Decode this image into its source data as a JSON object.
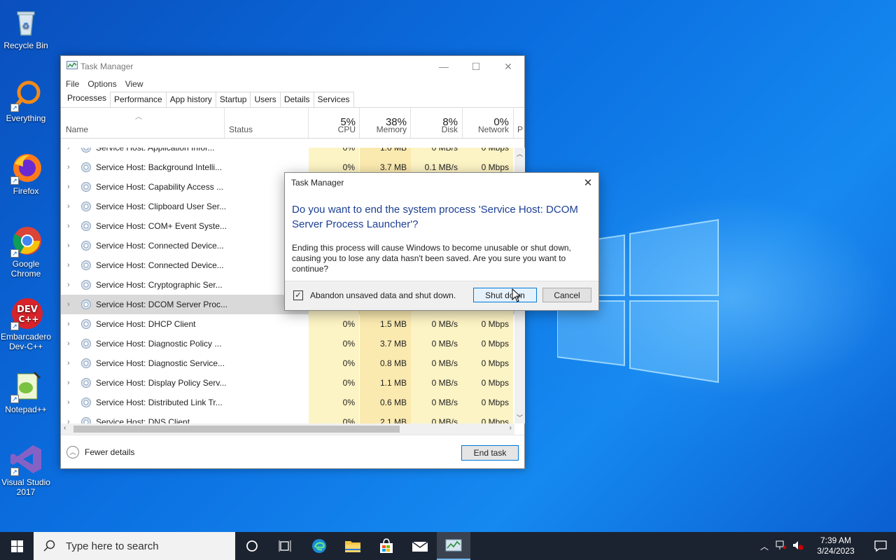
{
  "desktop": {
    "icons": [
      {
        "label": "Recycle Bin"
      },
      {
        "label": "Everything"
      },
      {
        "label": "Firefox"
      },
      {
        "label": "Google Chrome"
      },
      {
        "label": "Embarcadero Dev-C++"
      },
      {
        "label": "Notepad++"
      },
      {
        "label": "Visual Studio 2017"
      }
    ]
  },
  "task_manager": {
    "title": "Task Manager",
    "menu": [
      "File",
      "Options",
      "View"
    ],
    "tabs": [
      "Processes",
      "Performance",
      "App history",
      "Startup",
      "Users",
      "Details",
      "Services"
    ],
    "active_tab": "Processes",
    "columns": {
      "name": "Name",
      "status": "Status",
      "cpu": {
        "pct": "5%",
        "label": "CPU"
      },
      "memory": {
        "pct": "38%",
        "label": "Memory"
      },
      "disk": {
        "pct": "8%",
        "label": "Disk"
      },
      "network": {
        "pct": "0%",
        "label": "Network"
      },
      "power": "P"
    },
    "rows": [
      {
        "name": "Service Host: Application Infor...",
        "cpu": "0%",
        "mem": "1.0 MB",
        "disk": "0 MB/s",
        "net": "0 Mbps"
      },
      {
        "name": "Service Host: Background Intelli...",
        "cpu": "0%",
        "mem": "3.7 MB",
        "disk": "0.1 MB/s",
        "net": "0 Mbps"
      },
      {
        "name": "Service Host: Capability Access ...",
        "cpu": "",
        "mem": "",
        "disk": "",
        "net": ""
      },
      {
        "name": "Service Host: Clipboard User Ser...",
        "cpu": "",
        "mem": "",
        "disk": "",
        "net": ""
      },
      {
        "name": "Service Host: COM+ Event Syste...",
        "cpu": "",
        "mem": "",
        "disk": "",
        "net": ""
      },
      {
        "name": "Service Host: Connected Device...",
        "cpu": "",
        "mem": "",
        "disk": "",
        "net": ""
      },
      {
        "name": "Service Host: Connected Device...",
        "cpu": "",
        "mem": "",
        "disk": "",
        "net": ""
      },
      {
        "name": "Service Host: Cryptographic Ser...",
        "cpu": "",
        "mem": "",
        "disk": "",
        "net": ""
      },
      {
        "name": "Service Host: DCOM Server Proc...",
        "cpu": "",
        "mem": "",
        "disk": "",
        "net": "",
        "selected": true
      },
      {
        "name": "Service Host: DHCP Client",
        "cpu": "0%",
        "mem": "1.5 MB",
        "disk": "0 MB/s",
        "net": "0 Mbps"
      },
      {
        "name": "Service Host: Diagnostic Policy ...",
        "cpu": "0%",
        "mem": "3.7 MB",
        "disk": "0 MB/s",
        "net": "0 Mbps"
      },
      {
        "name": "Service Host: Diagnostic Service...",
        "cpu": "0%",
        "mem": "0.8 MB",
        "disk": "0 MB/s",
        "net": "0 Mbps"
      },
      {
        "name": "Service Host: Display Policy Serv...",
        "cpu": "0%",
        "mem": "1.1 MB",
        "disk": "0 MB/s",
        "net": "0 Mbps"
      },
      {
        "name": "Service Host: Distributed Link Tr...",
        "cpu": "0%",
        "mem": "0.6 MB",
        "disk": "0 MB/s",
        "net": "0 Mbps"
      },
      {
        "name": "Service Host: DNS Client",
        "cpu": "0%",
        "mem": "2.1 MB",
        "disk": "0 MB/s",
        "net": "0 Mbps"
      }
    ],
    "fewer_details": "Fewer details",
    "end_task": "End task"
  },
  "dialog": {
    "title": "Task Manager",
    "heading": "Do you want to end the system process 'Service Host: DCOM Server Process Launcher'?",
    "body": "Ending this process will cause Windows to become unusable or shut down, causing you to lose any data hasn't been saved. Are you sure you want to continue?",
    "checkbox_label": "Abandon unsaved data and shut down.",
    "checkbox_checked": true,
    "shutdown_label": "Shut down",
    "cancel_label": "Cancel"
  },
  "taskbar": {
    "search_placeholder": "Type here to search",
    "time": "7:39 AM",
    "date": "3/24/2023"
  },
  "colors": {
    "accent": "#0078d7",
    "heading_blue": "#1c3f94",
    "cpu_highlight": "#fdf4c5"
  }
}
